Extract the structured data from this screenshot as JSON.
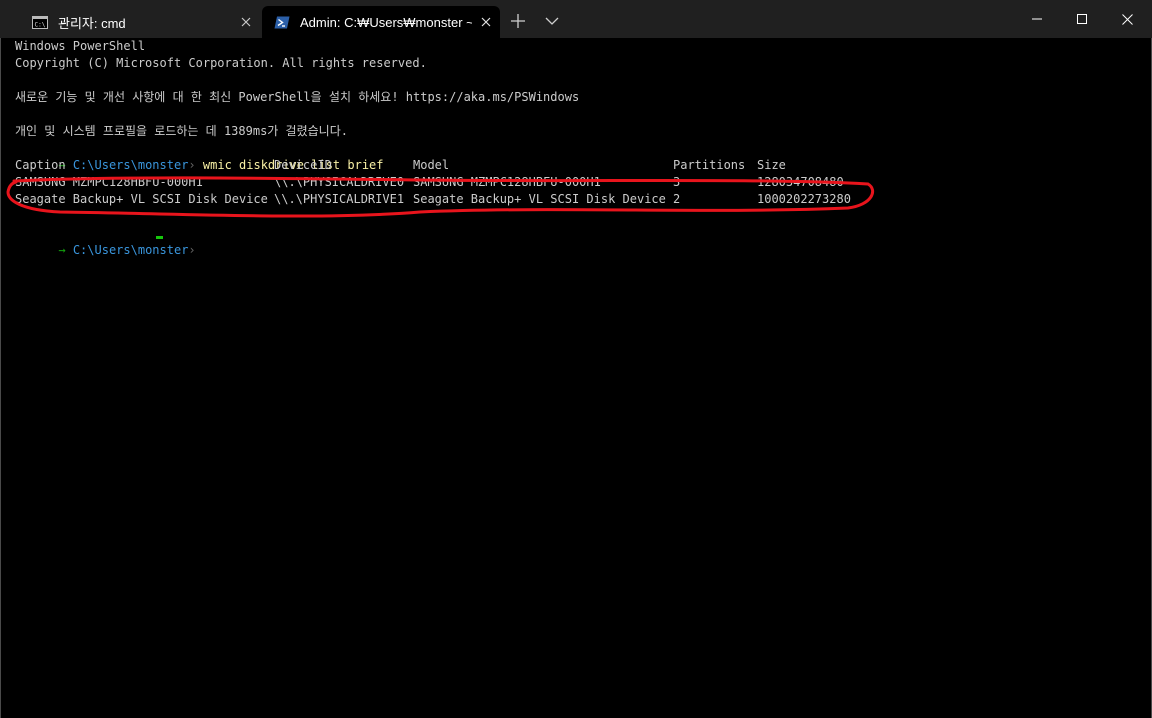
{
  "tabs": [
    {
      "title": "관리자: cmd",
      "icon": "cmd-icon"
    },
    {
      "title": "Admin: C:₩Users₩monster ~ P",
      "icon": "powershell-icon"
    }
  ],
  "terminal": {
    "banner_1": "Windows PowerShell",
    "banner_2": "Copyright (C) Microsoft Corporation. All rights reserved.",
    "update_notice": "새로운 기능 및 개선 사항에 대 한 최신 PowerShell을 설치 하세요! https://aka.ms/PSWindows",
    "profile_notice": "개인 및 시스템 프로필을 로드하는 데 1389ms가 걸렸습니다.",
    "prompt_arrow": "→",
    "prompt_path": "C:\\Users\\monster",
    "prompt_gt": "›",
    "command": "wmic diskdrive list brief",
    "table": {
      "headers": {
        "caption": "Caption",
        "device_id": "DeviceID",
        "model": "Model",
        "partitions": "Partitions",
        "size": "Size"
      },
      "rows": [
        {
          "caption": "SAMSUNG MZMPC128HBFU-000H1",
          "device_id": "\\\\.\\PHYSICALDRIVE0",
          "model": "SAMSUNG MZMPC128HBFU-000H1",
          "partitions": "3",
          "size": "128034708480"
        },
        {
          "caption": "Seagate Backup+ VL SCSI Disk Device",
          "device_id": "\\\\.\\PHYSICALDRIVE1",
          "model": "Seagate Backup+ VL SCSI Disk Device",
          "partitions": "2",
          "size": "1000202273280"
        }
      ]
    }
  },
  "colors": {
    "tabbar_bg": "#202020",
    "terminal_bg": "#000000",
    "text": "#cccccc",
    "prompt_arrow": "#13a10e",
    "prompt_path": "#3a96dd",
    "command": "#f9f1a5",
    "cursor": "#16c60c",
    "annotation": "#e8141c"
  }
}
